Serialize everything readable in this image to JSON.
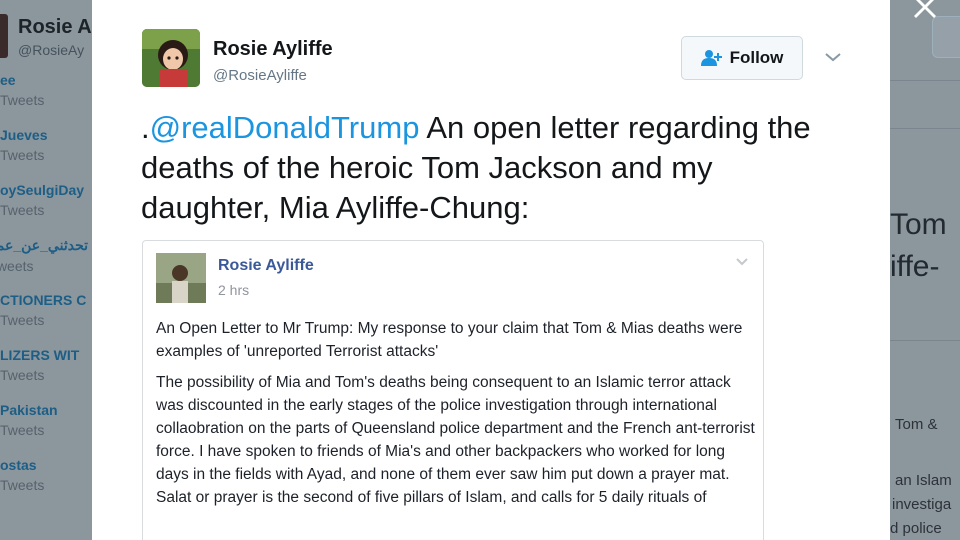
{
  "background": {
    "left_profile": {
      "name": "Rosie A",
      "handle": "@RosieAy"
    },
    "trends": [
      {
        "name": "ee",
        "count": "Tweets"
      },
      {
        "name": "Jueves",
        "count": "Tweets"
      },
      {
        "name": "oySeulgiDay",
        "count": "Tweets"
      },
      {
        "name": "تحدثني_عن_عمر",
        "count": "Tweets"
      },
      {
        "name": "CTIONERS C",
        "count": "Tweets"
      },
      {
        "name": "LIZERS WIT",
        "count": "Tweets"
      },
      {
        "name": "Pakistan",
        "count": "Tweets"
      },
      {
        "name": "ostas",
        "count": "Tweets"
      }
    ],
    "right_text": {
      "line1": "Tom",
      "line2": "iffe-",
      "snippet1": "Tom &",
      "snippet2": "an Islam",
      "snippet3": "investiga",
      "snippet4": "d police"
    }
  },
  "tweet": {
    "author_name": "Rosie Ayliffe",
    "author_handle": "@RosieAyliffe",
    "follow_label": "Follow",
    "text_prefix": ".",
    "mention": "@realDonaldTrump",
    "text_body": " An open letter regarding the deaths of the heroic Tom Jackson and my daughter, Mia Ayliffe-Chung:"
  },
  "embedded_post": {
    "author": "Rosie Ayliffe",
    "time": "2 hrs",
    "heading": "An Open Letter to Mr Trump: My response to your claim that Tom & Mias deaths were examples of 'unreported Terrorist attacks'",
    "body": "The possibility of Mia and Tom's deaths being consequent to an Islamic terror attack was discounted in the early stages of the police investigation through international collaobration on the parts of Queensland police department and the French ant-terrorist force. I have spoken to friends of Mia's and other backpackers who worked for long days in the fields with Ayad, and none of them ever saw him put down a prayer mat. Salat or prayer is the second of five pillars of Islam, and calls for 5 daily rituals of"
  },
  "colors": {
    "mention": "#1b95e0",
    "fb_name": "#3b5998",
    "overlay": "#7f8a92"
  },
  "icons": {
    "close": "close-icon",
    "follow": "add-user-icon",
    "caret": "chevron-down-icon"
  }
}
